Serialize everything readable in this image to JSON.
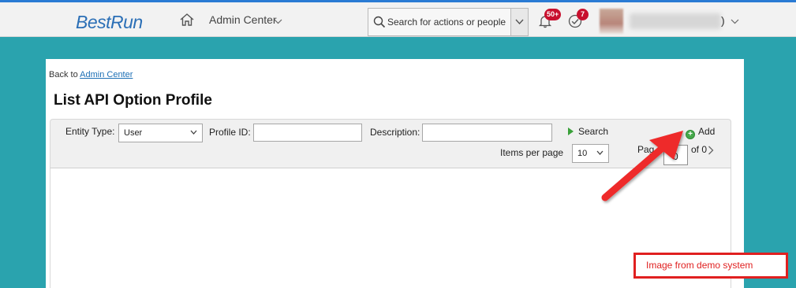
{
  "header": {
    "logo_text_a": "Best",
    "logo_text_b": "Run",
    "nav_label": "Admin Center",
    "search_placeholder": "Search for actions or people",
    "notifications_badge": "50+",
    "todo_badge": "7",
    "user_suffix": ")"
  },
  "breadcrumb": {
    "prefix": "Back to ",
    "link": "Admin Center"
  },
  "page": {
    "title": "List API Option Profile"
  },
  "filters": {
    "entity_type_label": "Entity Type:",
    "entity_type_value": "User",
    "profile_id_label": "Profile ID:",
    "profile_id_value": "",
    "description_label": "Description:",
    "description_value": "",
    "search_label": "Search",
    "add_label": "Add",
    "items_per_page_label": "Items per page",
    "items_per_page_value": "10",
    "page_label": "Pag",
    "page_value": "0",
    "of_total": "of 0"
  },
  "annotation": {
    "demo_label": "Image from demo system",
    "accent_color": "#e02020"
  },
  "icons": [
    "home-icon",
    "chevron-down-icon",
    "search-icon",
    "bell-icon",
    "todo-check-icon",
    "add-icon",
    "play-icon",
    "chevron-right-icon"
  ]
}
